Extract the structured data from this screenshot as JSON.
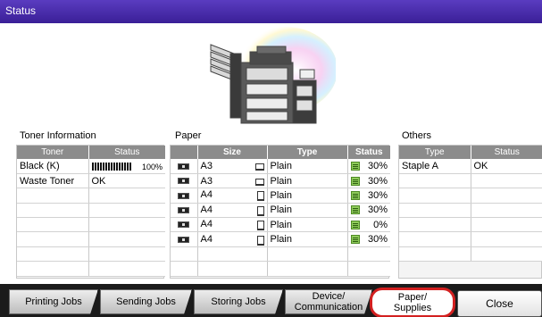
{
  "window": {
    "title": "Status"
  },
  "toner": {
    "section_title": "Toner Information",
    "headers": [
      "Toner",
      "Status"
    ],
    "rows": [
      {
        "name": "Black (K)",
        "level": "100%",
        "level_fraction": 1.0
      },
      {
        "name": "Waste Toner",
        "status": "OK"
      }
    ]
  },
  "paper": {
    "section_title": "Paper",
    "headers": [
      "",
      "Size",
      "Type",
      "Status"
    ],
    "rows": [
      {
        "size": "A3",
        "orientation": "landscape",
        "type": "Plain",
        "status": "30%"
      },
      {
        "size": "A3",
        "orientation": "landscape",
        "type": "Plain",
        "status": "30%"
      },
      {
        "size": "A4",
        "orientation": "portrait",
        "type": "Plain",
        "status": "30%"
      },
      {
        "size": "A4",
        "orientation": "portrait",
        "type": "Plain",
        "status": "30%"
      },
      {
        "size": "A4",
        "orientation": "portrait",
        "type": "Plain",
        "status": "0%"
      },
      {
        "size": "A4",
        "orientation": "portrait",
        "type": "Plain",
        "status": "30%"
      }
    ]
  },
  "others": {
    "section_title": "Others",
    "headers": [
      "Type",
      "Status"
    ],
    "rows": [
      {
        "type": "Staple A",
        "status": "OK"
      }
    ]
  },
  "tabs": [
    {
      "label": "Printing Jobs"
    },
    {
      "label": "Sending Jobs"
    },
    {
      "label": "Storing Jobs"
    },
    {
      "label": "Device/\nCommunication"
    },
    {
      "label": "Paper/\nSupplies",
      "selected": true
    }
  ],
  "close_label": "Close",
  "colors": {
    "title_bar": "#4a2eb0",
    "active_tab_highlight": "#d32020",
    "table_header": "#8c8c8c",
    "level_icon": "#8fcc5a"
  },
  "icons": [
    "printer-illustration",
    "tray-icon",
    "paper-orientation-icon",
    "paper-level-icon",
    "toner-level-bar"
  ]
}
